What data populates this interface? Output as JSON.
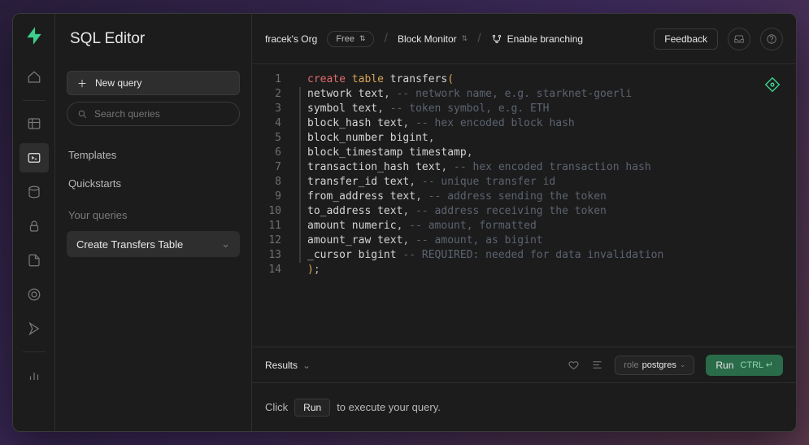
{
  "app": {
    "title": "SQL Editor"
  },
  "sidebar": {
    "new_query": "New query",
    "search_placeholder": "Search queries",
    "templates": "Templates",
    "quickstarts": "Quickstarts",
    "your_queries": "Your queries",
    "active_query": "Create Transfers Table"
  },
  "topbar": {
    "org": "fracek's Org",
    "plan": "Free",
    "project": "Block Monitor",
    "branching": "Enable branching",
    "feedback": "Feedback"
  },
  "editor": {
    "lines": [
      {
        "n": 1,
        "tokens": [
          [
            "kw",
            "create"
          ],
          [
            "sp",
            " "
          ],
          [
            "type",
            "table"
          ],
          [
            "sp",
            " "
          ],
          [
            "ident",
            "transfers"
          ],
          [
            "paren",
            "("
          ]
        ]
      },
      {
        "n": 2,
        "tokens": [
          [
            "ident",
            "network"
          ],
          [
            "sp",
            " "
          ],
          [
            "ident",
            "text"
          ],
          [
            "punct",
            ","
          ],
          [
            "sp",
            " "
          ],
          [
            "comment",
            "-- network name, e.g. starknet-goerli"
          ]
        ]
      },
      {
        "n": 3,
        "tokens": [
          [
            "ident",
            "symbol"
          ],
          [
            "sp",
            " "
          ],
          [
            "ident",
            "text"
          ],
          [
            "punct",
            ","
          ],
          [
            "sp",
            " "
          ],
          [
            "comment",
            "-- token symbol, e.g. ETH"
          ]
        ]
      },
      {
        "n": 4,
        "tokens": [
          [
            "ident",
            "block_hash"
          ],
          [
            "sp",
            " "
          ],
          [
            "ident",
            "text"
          ],
          [
            "punct",
            ","
          ],
          [
            "sp",
            " "
          ],
          [
            "comment",
            "-- hex encoded block hash"
          ]
        ]
      },
      {
        "n": 5,
        "tokens": [
          [
            "ident",
            "block_number"
          ],
          [
            "sp",
            " "
          ],
          [
            "ident",
            "bigint"
          ],
          [
            "punct",
            ","
          ]
        ]
      },
      {
        "n": 6,
        "tokens": [
          [
            "ident",
            "block_timestamp"
          ],
          [
            "sp",
            " "
          ],
          [
            "ident",
            "timestamp"
          ],
          [
            "punct",
            ","
          ]
        ]
      },
      {
        "n": 7,
        "tokens": [
          [
            "ident",
            "transaction_hash"
          ],
          [
            "sp",
            " "
          ],
          [
            "ident",
            "text"
          ],
          [
            "punct",
            ","
          ],
          [
            "sp",
            " "
          ],
          [
            "comment",
            "-- hex encoded transaction hash"
          ]
        ]
      },
      {
        "n": 8,
        "tokens": [
          [
            "ident",
            "transfer_id"
          ],
          [
            "sp",
            " "
          ],
          [
            "ident",
            "text"
          ],
          [
            "punct",
            ","
          ],
          [
            "sp",
            " "
          ],
          [
            "comment",
            "-- unique transfer id"
          ]
        ]
      },
      {
        "n": 9,
        "tokens": [
          [
            "ident",
            "from_address"
          ],
          [
            "sp",
            " "
          ],
          [
            "ident",
            "text"
          ],
          [
            "punct",
            ","
          ],
          [
            "sp",
            " "
          ],
          [
            "comment",
            "-- address sending the token"
          ]
        ]
      },
      {
        "n": 10,
        "tokens": [
          [
            "ident",
            "to_address"
          ],
          [
            "sp",
            " "
          ],
          [
            "ident",
            "text"
          ],
          [
            "punct",
            ","
          ],
          [
            "sp",
            " "
          ],
          [
            "comment",
            "-- address receiving the token"
          ]
        ]
      },
      {
        "n": 11,
        "tokens": [
          [
            "ident",
            "amount"
          ],
          [
            "sp",
            " "
          ],
          [
            "ident",
            "numeric"
          ],
          [
            "punct",
            ","
          ],
          [
            "sp",
            " "
          ],
          [
            "comment",
            "-- amount, formatted"
          ]
        ]
      },
      {
        "n": 12,
        "tokens": [
          [
            "ident",
            "amount_raw"
          ],
          [
            "sp",
            " "
          ],
          [
            "ident",
            "text"
          ],
          [
            "punct",
            ","
          ],
          [
            "sp",
            " "
          ],
          [
            "comment",
            "-- amount, as bigint"
          ]
        ]
      },
      {
        "n": 13,
        "tokens": [
          [
            "ident",
            "_cursor"
          ],
          [
            "sp",
            " "
          ],
          [
            "ident",
            "bigint"
          ],
          [
            "sp",
            " "
          ],
          [
            "comment",
            "-- REQUIRED: needed for data invalidation"
          ]
        ]
      },
      {
        "n": 14,
        "tokens": [
          [
            "paren",
            ")"
          ],
          [
            "punct",
            ";"
          ]
        ]
      }
    ]
  },
  "results": {
    "label": "Results",
    "role_label": "role",
    "role_value": "postgres",
    "run": "Run",
    "run_hint": "CTRL ↵",
    "hint_pre": "Click",
    "hint_run": "Run",
    "hint_post": "to execute your query."
  }
}
